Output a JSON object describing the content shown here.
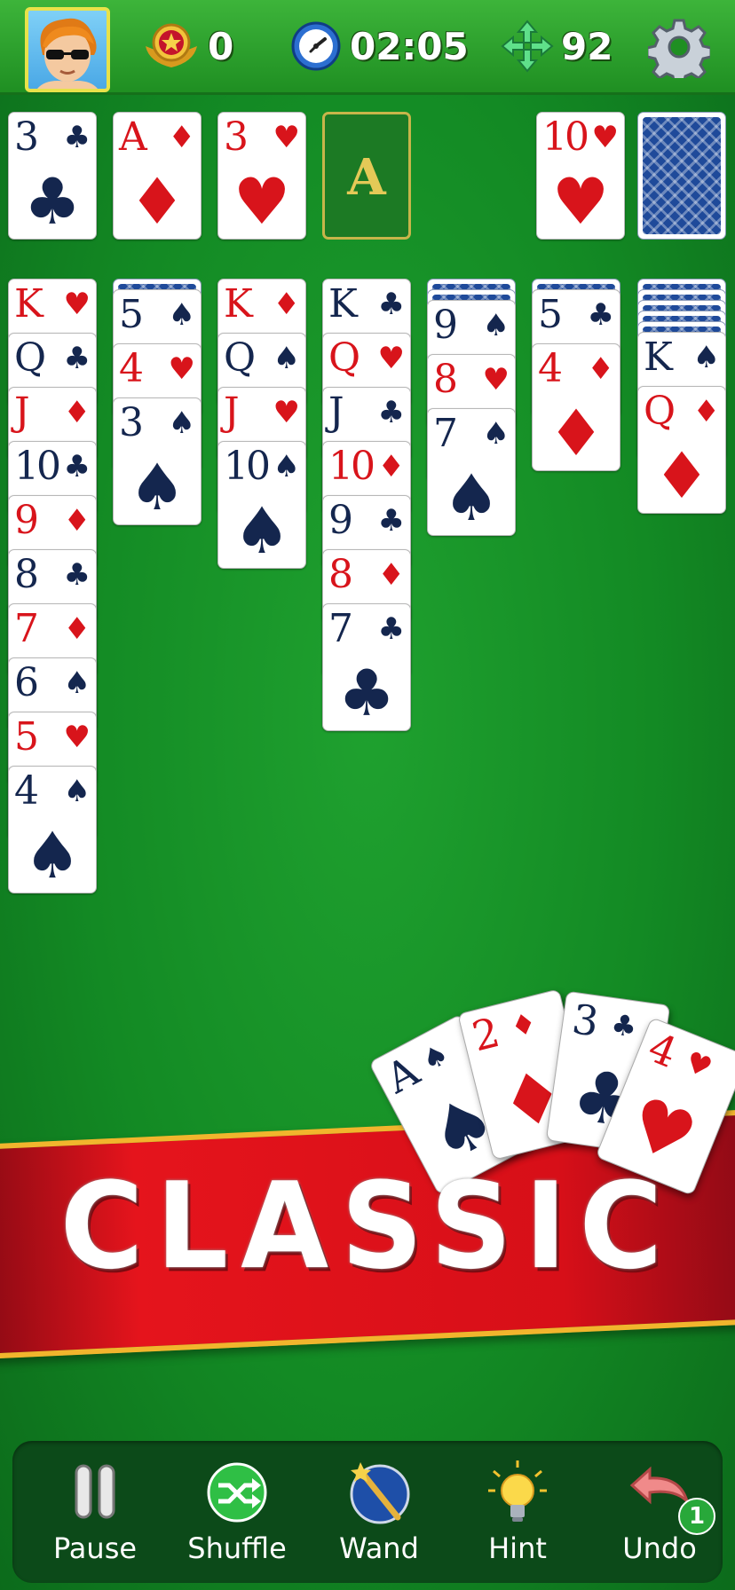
{
  "stats": {
    "score": "0",
    "time": "02:05",
    "moves": "92"
  },
  "foundation": [
    {
      "rank": "3",
      "suit": "♣",
      "color": "black"
    },
    {
      "rank": "A",
      "suit": "♦",
      "color": "red"
    },
    {
      "rank": "3",
      "suit": "♥",
      "color": "red"
    },
    {
      "placeholder": "A"
    }
  ],
  "waste": {
    "rank": "10",
    "suit": "♥",
    "color": "red"
  },
  "tableau": [
    {
      "hidden": 0,
      "cards": [
        {
          "rank": "K",
          "suit": "♥",
          "color": "red"
        },
        {
          "rank": "Q",
          "suit": "♣",
          "color": "black"
        },
        {
          "rank": "J",
          "suit": "♦",
          "color": "red"
        },
        {
          "rank": "10",
          "suit": "♣",
          "color": "black"
        },
        {
          "rank": "9",
          "suit": "♦",
          "color": "red"
        },
        {
          "rank": "8",
          "suit": "♣",
          "color": "black"
        },
        {
          "rank": "7",
          "suit": "♦",
          "color": "red"
        },
        {
          "rank": "6",
          "suit": "♠",
          "color": "black"
        },
        {
          "rank": "5",
          "suit": "♥",
          "color": "red"
        },
        {
          "rank": "4",
          "suit": "♠",
          "color": "black"
        }
      ]
    },
    {
      "hidden": 1,
      "cards": [
        {
          "rank": "5",
          "suit": "♠",
          "color": "black"
        },
        {
          "rank": "4",
          "suit": "♥",
          "color": "red"
        },
        {
          "rank": "3",
          "suit": "♠",
          "color": "black"
        }
      ]
    },
    {
      "hidden": 0,
      "cards": [
        {
          "rank": "K",
          "suit": "♦",
          "color": "red"
        },
        {
          "rank": "Q",
          "suit": "♠",
          "color": "black"
        },
        {
          "rank": "J",
          "suit": "♥",
          "color": "red"
        },
        {
          "rank": "10",
          "suit": "♠",
          "color": "black"
        }
      ]
    },
    {
      "hidden": 0,
      "cards": [
        {
          "rank": "K",
          "suit": "♣",
          "color": "black"
        },
        {
          "rank": "Q",
          "suit": "♥",
          "color": "red"
        },
        {
          "rank": "J",
          "suit": "♣",
          "color": "black"
        },
        {
          "rank": "10",
          "suit": "♦",
          "color": "red"
        },
        {
          "rank": "9",
          "suit": "♣",
          "color": "black"
        },
        {
          "rank": "8",
          "suit": "♦",
          "color": "red"
        },
        {
          "rank": "7",
          "suit": "♣",
          "color": "black"
        }
      ]
    },
    {
      "hidden": 2,
      "cards": [
        {
          "rank": "9",
          "suit": "♠",
          "color": "black"
        },
        {
          "rank": "8",
          "suit": "♥",
          "color": "red"
        },
        {
          "rank": "7",
          "suit": "♠",
          "color": "black"
        }
      ]
    },
    {
      "hidden": 1,
      "cards": [
        {
          "rank": "5",
          "suit": "♣",
          "color": "black"
        },
        {
          "rank": "4",
          "suit": "♦",
          "color": "red"
        }
      ]
    },
    {
      "hidden": 5,
      "cards": [
        {
          "rank": "K",
          "suit": "♠",
          "color": "black"
        },
        {
          "rank": "Q",
          "suit": "♦",
          "color": "red"
        }
      ]
    }
  ],
  "banner": {
    "title": "CLASSIC",
    "fan": [
      {
        "rank": "A",
        "suit": "♠",
        "color": "black"
      },
      {
        "rank": "2",
        "suit": "♦",
        "color": "red"
      },
      {
        "rank": "3",
        "suit": "♣",
        "color": "black"
      },
      {
        "rank": "4",
        "suit": "♥",
        "color": "red"
      }
    ]
  },
  "toolbar": {
    "pause": "Pause",
    "shuffle": "Shuffle",
    "wand": "Wand",
    "hint": "Hint",
    "undo": "Undo",
    "undo_count": "1"
  },
  "colors": {
    "red": "#d8141b",
    "black": "#14264e",
    "felt": "#138a24"
  }
}
